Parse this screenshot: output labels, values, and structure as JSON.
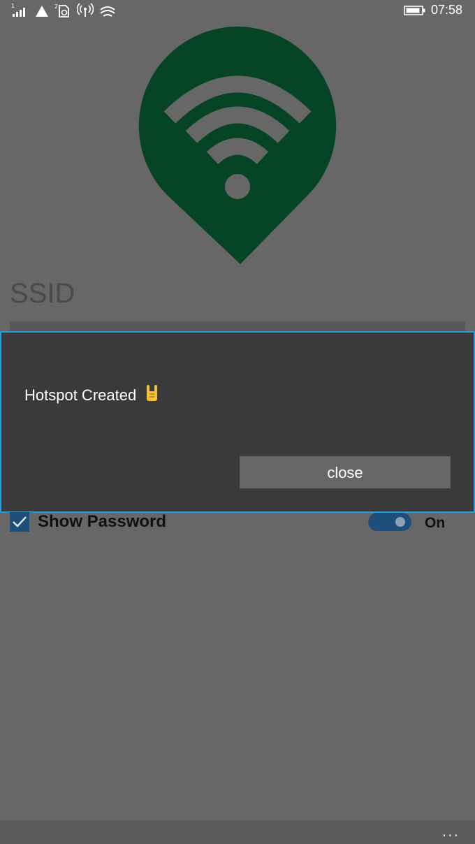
{
  "status_bar": {
    "time": "07:58",
    "icons": [
      "signal-icon",
      "sim-notification-icon",
      "sim2-icon",
      "hotspot-broadcast-icon",
      "wifi-icon",
      "battery-icon"
    ]
  },
  "logo": {
    "icon": "wifi-location-pin-icon",
    "color": "#054525"
  },
  "form": {
    "ssid_label": "SSID",
    "show_password_label": "Show Password",
    "show_password_checked": true,
    "toggle_label": "On",
    "toggle_on": true
  },
  "dialog": {
    "message": "Hotspot Created",
    "emoji": "rock-on-hand-icon",
    "close_label": "close",
    "accent": "#1ba1e2"
  },
  "app_bar": {
    "more_label": "..."
  }
}
